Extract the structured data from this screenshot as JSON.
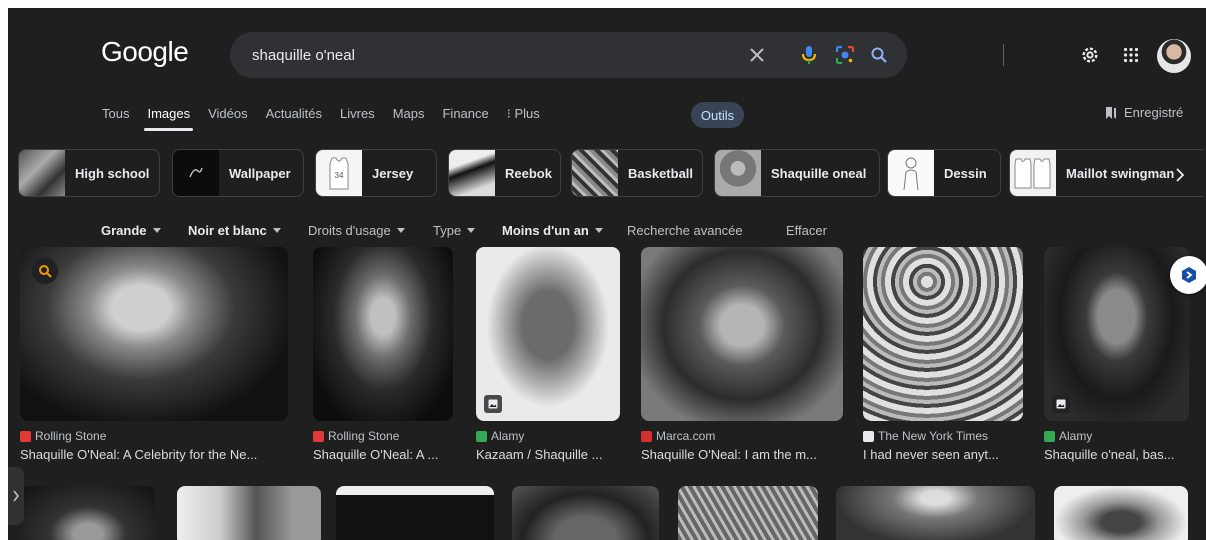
{
  "header": {
    "logo": "Google",
    "search_value": "shaquille o'neal",
    "icons": [
      "clear-icon",
      "mic-icon",
      "lens-icon",
      "search-icon",
      "settings-gear-icon",
      "apps-grid-icon"
    ]
  },
  "tabs": {
    "items": [
      "Tous",
      "Images",
      "Vidéos",
      "Actualités",
      "Livres",
      "Maps",
      "Finance",
      "⁝ Plus"
    ],
    "active": "Images",
    "tools": "Outils",
    "saved": "Enregistré"
  },
  "chips": [
    "High school",
    "Wallpaper",
    "Jersey",
    "Reebok",
    "Basketball",
    "Shaquille oneal",
    "Dessin",
    "Maillot swingman"
  ],
  "filters": [
    {
      "label": "Grande",
      "dropdown": true,
      "bold": true
    },
    {
      "label": "Noir et blanc",
      "dropdown": true,
      "bold": true
    },
    {
      "label": "Droits d'usage",
      "dropdown": true,
      "bold": false
    },
    {
      "label": "Type",
      "dropdown": true,
      "bold": false
    },
    {
      "label": "Moins d'un an",
      "dropdown": true,
      "bold": true
    },
    {
      "label": "Recherche avancée",
      "dropdown": false,
      "bold": false
    },
    {
      "label": "Effacer",
      "dropdown": false,
      "bold": false
    }
  ],
  "results": [
    {
      "source": "Rolling Stone",
      "title": "Shaquille O'Neal: A Celebrity for the Ne...",
      "favicon_color": "#e53935"
    },
    {
      "source": "Rolling Stone",
      "title": "Shaquille O'Neal: A ...",
      "favicon_color": "#e53935"
    },
    {
      "source": "Alamy",
      "title": "Kazaam / Shaquille ...",
      "favicon_color": "#34a853"
    },
    {
      "source": "Marca.com",
      "title": "Shaquille O'Neal: I am the m...",
      "favicon_color": "#d32f2f"
    },
    {
      "source": "The New York Times",
      "title": "I had never seen anyt...",
      "favicon_color": "#e8eaed"
    },
    {
      "source": "Alamy",
      "title": "Shaquille o'neal, bas...",
      "favicon_color": "#34a853"
    }
  ]
}
